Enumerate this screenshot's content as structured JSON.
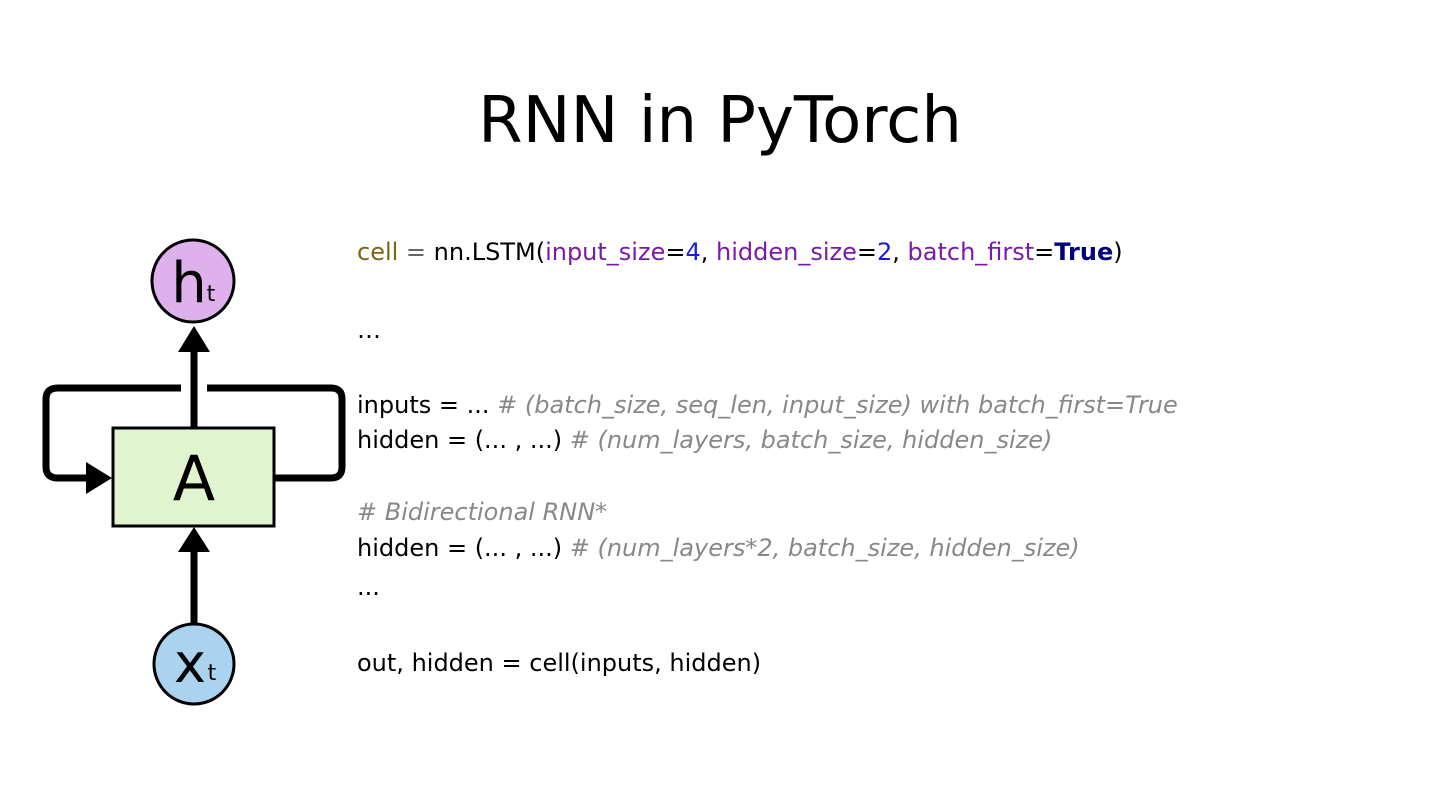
{
  "slide": {
    "title": "RNN in PyTorch"
  },
  "diagram": {
    "output_node": {
      "label": "h",
      "subscript": "t"
    },
    "cell": {
      "label": "A"
    },
    "input_node": {
      "label": "x",
      "subscript": "t"
    },
    "colors": {
      "output_fill": "#dfb1ec",
      "cell_fill": "#e0f5cf",
      "input_fill": "#a9d3ee",
      "stroke": "#000000"
    }
  },
  "code": {
    "line1": {
      "var": "cell",
      "assign": " = ",
      "call": "nn.LSTM(",
      "arg1": "input_size",
      "eq1": "=",
      "val1": "4",
      "sep1": ", ",
      "arg2": "hidden_size",
      "eq2": "=",
      "val2": "2",
      "sep2": ", ",
      "arg3": "batch_first",
      "eq3": "=",
      "val3": "True",
      "close": ")"
    },
    "ellipsis1": "…",
    "line_inputs": {
      "code": "inputs = ... ",
      "comment": "# (batch_size, seq_len, input_size) with batch_first=True"
    },
    "line_hidden": {
      "code": "hidden = (... , ...) ",
      "comment": "# (num_layers, batch_size, hidden_size)"
    },
    "comment_bidir": "# Bidirectional RNN*",
    "line_hidden_bidir": {
      "code": "hidden = (... , ...) ",
      "comment": "# (num_layers*2, batch_size, hidden_size)"
    },
    "ellipsis2": "...",
    "line_out": "out, hidden = cell(inputs, hidden)"
  },
  "colors": {
    "var": "#7a6613",
    "operator": "#666666",
    "argument": "#7a1aa8",
    "number": "#1a1ae0",
    "boolean": "#000080",
    "comment": "#888888"
  }
}
